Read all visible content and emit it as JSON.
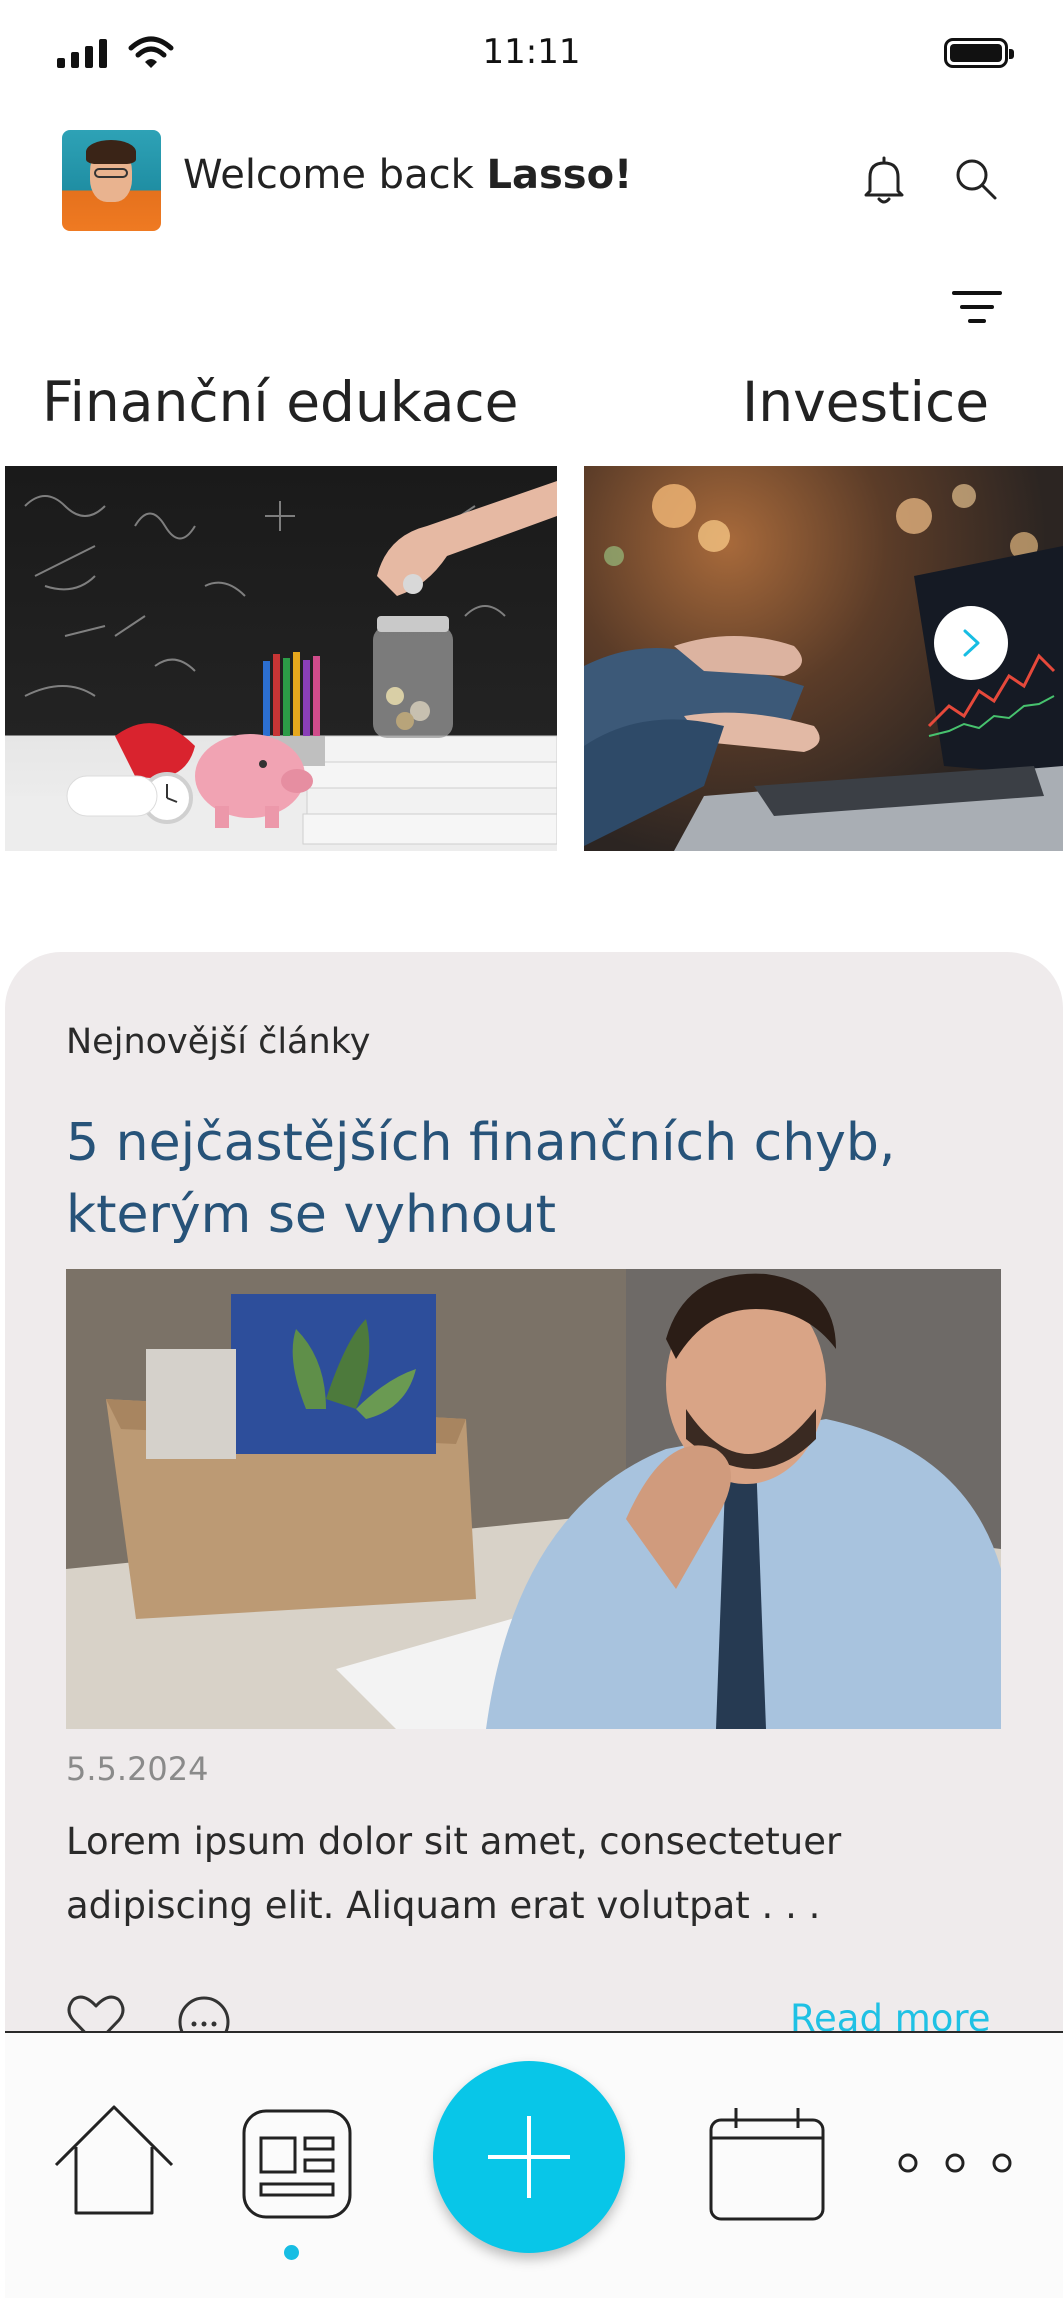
{
  "status_bar": {
    "time": "11:11"
  },
  "header": {
    "welcome_prefix": "Welcome back ",
    "user_name": "Lasso!"
  },
  "categories": [
    {
      "label": "Finanční edukace"
    },
    {
      "label": "Investice"
    }
  ],
  "latest": {
    "section_label": "Nejnovější články",
    "title": "5 nejčastějších finančních chyb, kterým se vyhnout",
    "date": "5.5.2024",
    "excerpt": "Lorem ipsum dolor sit amet, consectetuer adipiscing elit. Aliquam erat volutpat . . .",
    "read_more_label": "Read more"
  },
  "nav": {
    "items": [
      {
        "icon": "home-icon"
      },
      {
        "icon": "news-icon",
        "active": true
      },
      {
        "icon": "plus-icon"
      },
      {
        "icon": "calendar-icon"
      },
      {
        "icon": "more-icon"
      }
    ]
  },
  "colors": {
    "accent": "#08c6e8",
    "title_blue": "#275379",
    "card_bg": "#efebec",
    "read_more": "#1fc1e4"
  }
}
